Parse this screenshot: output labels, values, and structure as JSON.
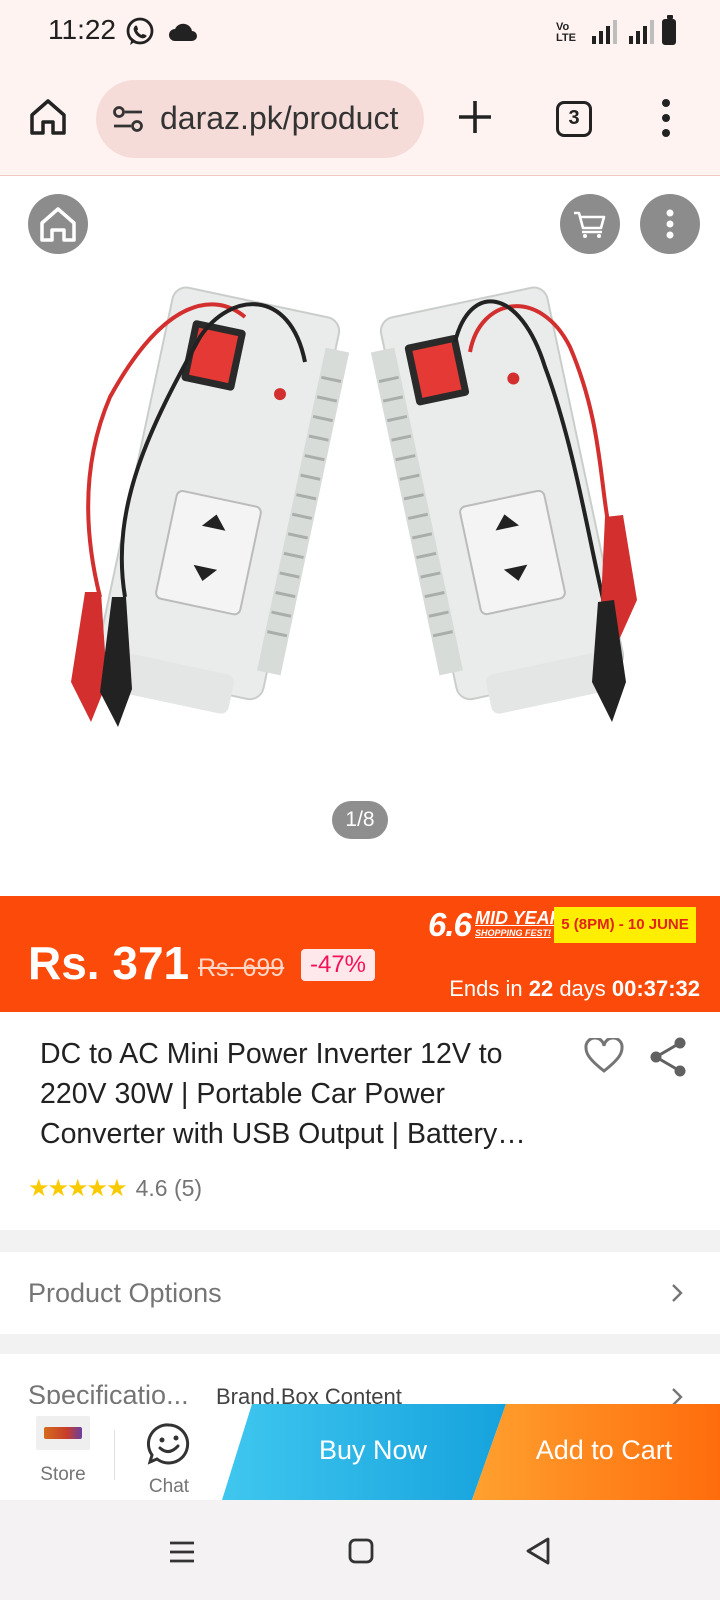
{
  "status_bar": {
    "time": "11:22",
    "volte": "Vo LTE",
    "icons": [
      "whatsapp-icon",
      "cloud-icon",
      "volte-icon",
      "signal-icon",
      "signal-icon",
      "battery-icon"
    ]
  },
  "browser": {
    "url": "daraz.pk/product",
    "tab_count": "3",
    "icons": [
      "home-icon",
      "tune-icon",
      "plus-icon",
      "tabs-icon",
      "more-vert-icon"
    ]
  },
  "gallery": {
    "counter": "1/8",
    "icons": [
      "home-icon",
      "cart-icon",
      "more-vert-icon"
    ]
  },
  "price": {
    "current": "Rs. 371",
    "original": "Rs. 699",
    "discount": "-47%",
    "festival_number": "6.6",
    "festival_name": "MID YEAR",
    "festival_sub": "SHOPPING FEST!",
    "festival_dates": "5 (8PM) - 10 JUNE",
    "ends_prefix": "Ends in",
    "ends_days": "22",
    "ends_days_label": "days",
    "ends_time": "00:37:32",
    "colors": {
      "banner": "#fc4a0b",
      "discount_text": "#f5115a",
      "date_badge": "#ffee00"
    }
  },
  "product": {
    "title": "DC to AC Mini Power Inverter 12V to 220V 30W | Portable Car Power Converter with USB Output | Battery…",
    "rating": "4.6",
    "review_count": "(5)",
    "stars": "★★★★★"
  },
  "sections": {
    "options_label": "Product Options",
    "spec_label": "Specificatio...",
    "spec_value": "Brand,Box Content"
  },
  "actions": {
    "store_label": "Store",
    "chat_label": "Chat",
    "buy_now": "Buy Now",
    "add_to_cart": "Add to Cart",
    "colors": {
      "buy_now": "#16a2dd",
      "add_to_cart": "#ff6c0c"
    }
  },
  "nav": {
    "icons": [
      "recents-icon",
      "home-icon",
      "back-icon"
    ]
  }
}
